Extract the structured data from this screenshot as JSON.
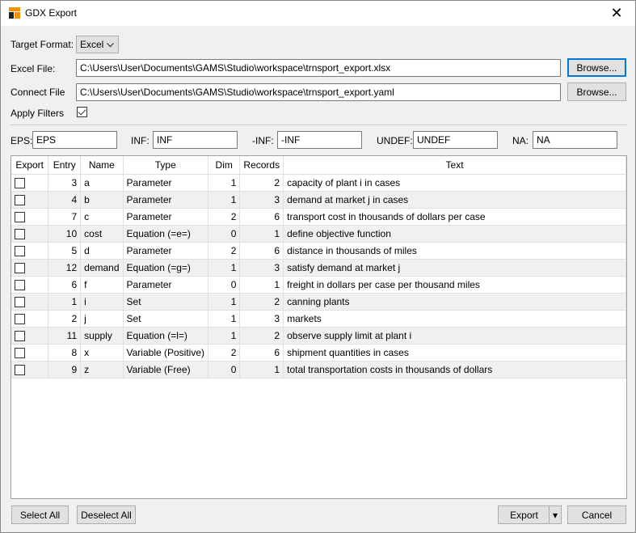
{
  "window": {
    "title": "GDX Export",
    "close_glyph": "✕"
  },
  "form": {
    "target_format_label": "Target Format:",
    "target_format_value": "Excel",
    "excel_file_label": "Excel File:",
    "excel_file_value": "C:\\Users\\User\\Documents\\GAMS\\Studio\\workspace\\trnsport_export.xlsx",
    "connect_file_label": "Connect File",
    "connect_file_value": "C:\\Users\\User\\Documents\\GAMS\\Studio\\workspace\\trnsport_export.yaml",
    "browse_label": "Browse...",
    "apply_filters_label": "Apply Filters",
    "apply_filters_checked": true
  },
  "specials": {
    "eps_label": "EPS:",
    "eps_value": "EPS",
    "inf_label": "INF:",
    "inf_value": "INF",
    "minf_label": "-INF:",
    "minf_value": "-INF",
    "undef_label": "UNDEF:",
    "undef_value": "UNDEF",
    "na_label": "NA:",
    "na_value": "NA"
  },
  "table": {
    "headers": [
      "Export",
      "Entry",
      "Name",
      "Type",
      "Dim",
      "Records",
      "Text"
    ],
    "sort_indicator": "^",
    "rows": [
      {
        "export": false,
        "entry": "3",
        "name": "a",
        "type": "Parameter",
        "dim": "1",
        "records": "2",
        "text": "capacity of plant i in cases"
      },
      {
        "export": false,
        "entry": "4",
        "name": "b",
        "type": "Parameter",
        "dim": "1",
        "records": "3",
        "text": "demand at market j in cases"
      },
      {
        "export": false,
        "entry": "7",
        "name": "c",
        "type": "Parameter",
        "dim": "2",
        "records": "6",
        "text": "transport cost in thousands of dollars per case"
      },
      {
        "export": false,
        "entry": "10",
        "name": "cost",
        "type": "Equation (=e=)",
        "dim": "0",
        "records": "1",
        "text": "define objective function"
      },
      {
        "export": false,
        "entry": "5",
        "name": "d",
        "type": "Parameter",
        "dim": "2",
        "records": "6",
        "text": "distance in thousands of miles"
      },
      {
        "export": false,
        "entry": "12",
        "name": "demand",
        "type": "Equation (=g=)",
        "dim": "1",
        "records": "3",
        "text": "satisfy demand at market j"
      },
      {
        "export": false,
        "entry": "6",
        "name": "f",
        "type": "Parameter",
        "dim": "0",
        "records": "1",
        "text": "freight in dollars per case per thousand miles"
      },
      {
        "export": false,
        "entry": "1",
        "name": "i",
        "type": "Set",
        "dim": "1",
        "records": "2",
        "text": "canning plants"
      },
      {
        "export": false,
        "entry": "2",
        "name": "j",
        "type": "Set",
        "dim": "1",
        "records": "3",
        "text": "markets"
      },
      {
        "export": false,
        "entry": "11",
        "name": "supply",
        "type": "Equation (=l=)",
        "dim": "1",
        "records": "2",
        "text": "observe supply limit at plant i"
      },
      {
        "export": false,
        "entry": "8",
        "name": "x",
        "type": "Variable (Positive)",
        "dim": "2",
        "records": "6",
        "text": "shipment quantities in cases"
      },
      {
        "export": false,
        "entry": "9",
        "name": "z",
        "type": "Variable (Free)",
        "dim": "0",
        "records": "1",
        "text": "total transportation costs in thousands of dollars"
      }
    ]
  },
  "footer": {
    "select_all_label": "Select All",
    "deselect_all_label": "Deselect All",
    "export_label": "Export",
    "export_dropdown_glyph": "▾",
    "cancel_label": "Cancel"
  },
  "colors": {
    "accent": "#0078d7",
    "alt_row": "#f0f0f0",
    "window_bg": "#f0f0f0"
  }
}
